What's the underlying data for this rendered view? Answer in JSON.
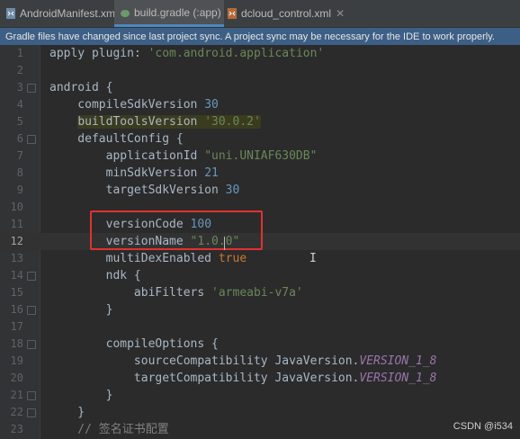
{
  "tabs": [
    {
      "label": "AndroidManifest.xml",
      "active": false
    },
    {
      "label": "build.gradle (:app)",
      "active": true
    },
    {
      "label": "dcloud_control.xml",
      "active": false
    }
  ],
  "banner": {
    "message": "Gradle files have changed since last project sync. A project sync may be necessary for the IDE to work properly."
  },
  "editor": {
    "lines": [
      {
        "num": "1",
        "code": "apply plugin: 'com.android.application'"
      },
      {
        "num": "2",
        "code": ""
      },
      {
        "num": "3",
        "code": "android {"
      },
      {
        "num": "4",
        "code": "    compileSdkVersion 30"
      },
      {
        "num": "5",
        "code": "    buildToolsVersion '30.0.2'"
      },
      {
        "num": "6",
        "code": "    defaultConfig {"
      },
      {
        "num": "7",
        "code": "        applicationId \"uni.UNIAF630DB\""
      },
      {
        "num": "8",
        "code": "        minSdkVersion 21"
      },
      {
        "num": "9",
        "code": "        targetSdkVersion 30"
      },
      {
        "num": "10",
        "code": ""
      },
      {
        "num": "11",
        "code": "        versionCode 100"
      },
      {
        "num": "12",
        "code": "        versionName \"1.0.0\""
      },
      {
        "num": "13",
        "code": "        multiDexEnabled true"
      },
      {
        "num": "14",
        "code": "        ndk {"
      },
      {
        "num": "15",
        "code": "            abiFilters 'armeabi-v7a'"
      },
      {
        "num": "16",
        "code": "        }"
      },
      {
        "num": "17",
        "code": ""
      },
      {
        "num": "18",
        "code": "        compileOptions {"
      },
      {
        "num": "19",
        "code": "            sourceCompatibility JavaVersion.VERSION_1_8"
      },
      {
        "num": "20",
        "code": "            targetCompatibility JavaVersion.VERSION_1_8"
      },
      {
        "num": "21",
        "code": "        }"
      },
      {
        "num": "22",
        "code": "    }"
      },
      {
        "num": "23",
        "code": "    // 签名证书配置"
      }
    ],
    "current_line": "12"
  },
  "watermark": "CSDN @i534",
  "colors": {
    "keyword": "#cc7832",
    "string": "#6a8759",
    "number": "#6897bb",
    "field": "#9876aa",
    "comment": "#808080",
    "highlight_box": "#e0322e",
    "banner": "#3d5f86"
  }
}
